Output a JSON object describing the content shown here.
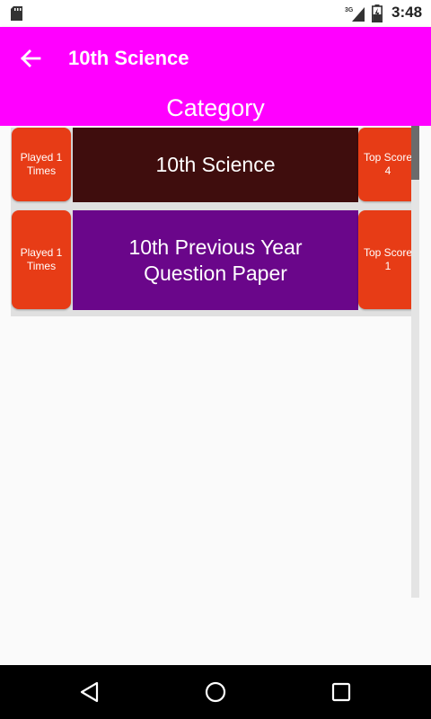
{
  "status_bar": {
    "time": "3:48",
    "network": "3G",
    "icons": [
      "sd-card-icon",
      "signal-icon",
      "battery-icon"
    ]
  },
  "app_bar": {
    "title": "10th Science",
    "back_icon": "arrow-back-icon",
    "color": "#ff00ff"
  },
  "category": {
    "label": "Category"
  },
  "list": {
    "items": [
      {
        "played_line1": "Played 1",
        "played_line2": "Times",
        "title_line1": "10th Science",
        "title_line2": "",
        "score_line1": "Top Score",
        "score_line2": "4",
        "color": "#3f0d0d"
      },
      {
        "played_line1": "Played 1",
        "played_line2": "Times",
        "title_line1": "10th Previous Year",
        "title_line2": "Question Paper",
        "score_line1": "Top Score",
        "score_line2": "1",
        "color": "#6a068a"
      }
    ],
    "side_color": "#e73c16"
  },
  "nav_bar": {
    "icons": [
      "nav-back-icon",
      "nav-home-icon",
      "nav-recents-icon"
    ]
  }
}
